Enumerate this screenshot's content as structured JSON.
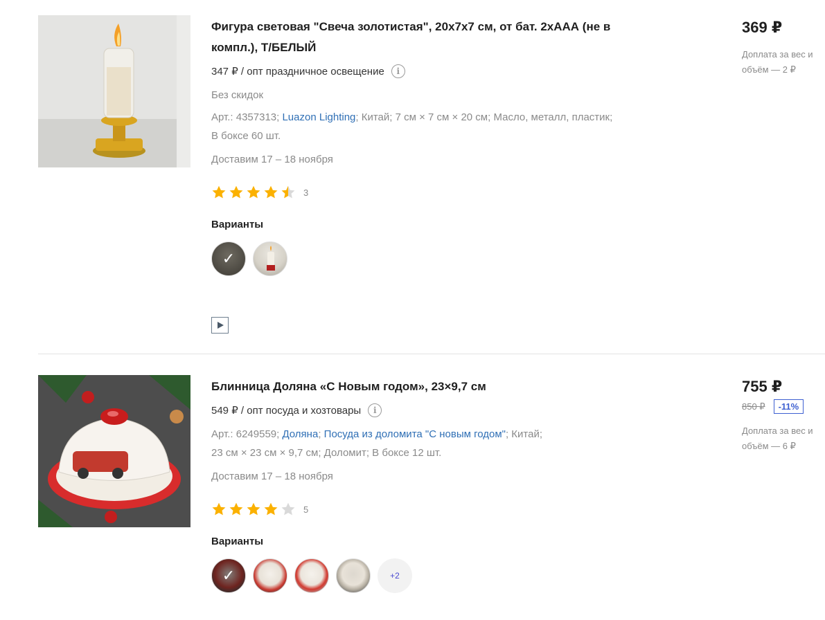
{
  "products": [
    {
      "title": "Фигура световая \"Свеча золотистая\", 20х7х7 см, от бат. 2хААА (не в компл.), Т/БЕЛЫЙ",
      "wholesale": "347 ₽ / опт праздничное освещение",
      "no_discount": "Без скидок",
      "specs_line1": {
        "art": "Арт.: 4357313;",
        "brand": "Luazon Lighting",
        "rest": "; Китай; 7 см × 7 см × 20 см; Масло, металл, пластик;"
      },
      "specs_line2": "В боксе 60 шт.",
      "delivery": "Доставим 17 – 18 ноября",
      "rating": 4.5,
      "reviews": "3",
      "variants_label": "Варианты",
      "price": "369 ₽",
      "extra": "Доплата за вес и объём — 2 ₽"
    },
    {
      "title": "Блинница Доляна «С Новым годом», 23×9,7 см",
      "wholesale": "549 ₽ / опт посуда и хозтовары",
      "specs_line1": {
        "art": "Арт.: 6249559;",
        "brand": "Доляна",
        "sep": ";",
        "collection": "Посуда из доломита \"С новым годом\"",
        "rest": "; Китай;"
      },
      "specs_line2": "23 см × 23 см × 9,7 см; Доломит; В боксе 12 шт.",
      "delivery": "Доставим 17 – 18 ноября",
      "rating": 4,
      "reviews": "5",
      "variants_label": "Варианты",
      "more_variants": "+2",
      "price": "755 ₽",
      "old_price": "850 ₽",
      "discount": "-11%",
      "extra": "Доплата за вес и объём — 6 ₽"
    }
  ],
  "colors": {
    "star": "#fbb100",
    "star_empty": "#d9d9d9",
    "link": "#2f6fb5",
    "discount": "#3d5fd1"
  }
}
